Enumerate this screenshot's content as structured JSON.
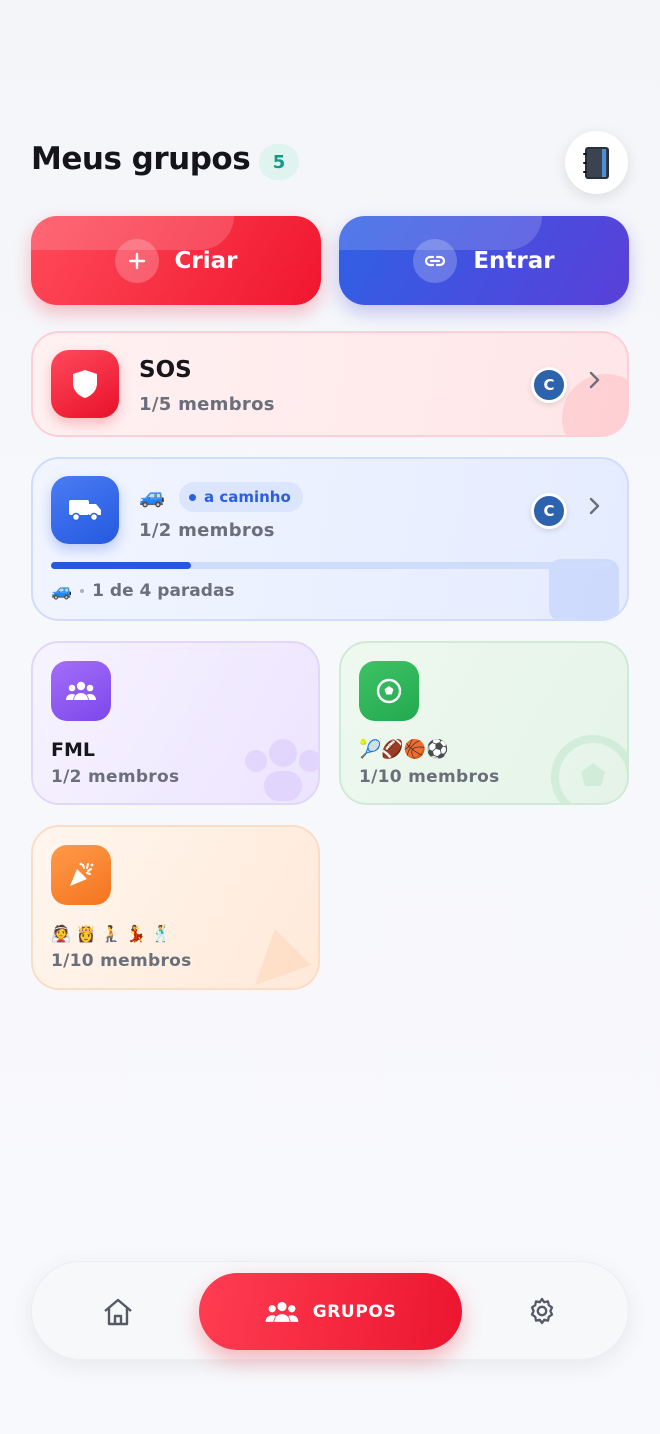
{
  "header": {
    "title": "Meus grupos",
    "count": "5"
  },
  "actions": {
    "create_label": "Criar",
    "join_label": "Entrar"
  },
  "groups": [
    {
      "name": "SOS",
      "members": "1/5 membros",
      "avatar": "C",
      "icon": "shield-icon",
      "color": "#f0162e"
    },
    {
      "name_emoji": "🚙",
      "status": "a caminho",
      "members": "1/2 membros",
      "avatar": "C",
      "icon": "truck-icon",
      "color": "#2559e0",
      "progress": 0.25,
      "stops_emoji": "🚙",
      "stops": "1 de 4 paradas"
    },
    {
      "name": "FML",
      "members": "1/2 membros",
      "icon": "group-icon",
      "color": "#7c47ec"
    },
    {
      "name_emoji": "🎾🏈🏀⚽",
      "members": "1/10 membros",
      "icon": "soccer-ball-icon",
      "color": "#22a94f"
    },
    {
      "name_emoji": "👰 👸 🧎 💃 🕺",
      "members": "1/10 membros",
      "icon": "party-popper-icon",
      "color": "#f4741e"
    }
  ],
  "nav": {
    "home": "home-icon",
    "active_label": "GRUPOS",
    "settings": "gear-icon"
  }
}
